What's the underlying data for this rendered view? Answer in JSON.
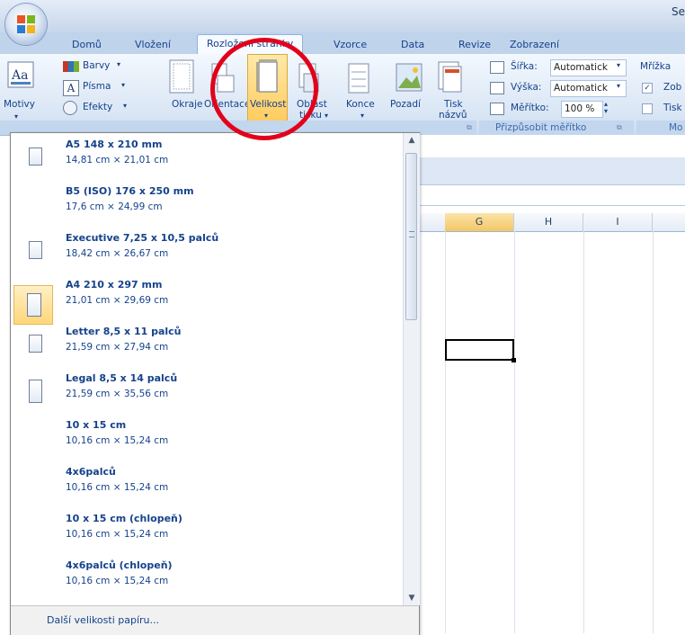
{
  "window": {
    "title_fragment": "Se"
  },
  "tabs": [
    {
      "label": "Domů",
      "active": false
    },
    {
      "label": "Vložení",
      "active": false
    },
    {
      "label": "Rozložení stránky",
      "active": true
    },
    {
      "label": "Vzorce",
      "active": false
    },
    {
      "label": "Data",
      "active": false
    },
    {
      "label": "Revize",
      "active": false
    },
    {
      "label": "Zobrazení",
      "active": false
    }
  ],
  "ribbon": {
    "motivy": {
      "label": "Motivy",
      "barvy": "Barvy",
      "pisma": "Písma",
      "efekty": "Efekty"
    },
    "page_setup": {
      "okraje": "Okraje",
      "orientace": "Orientace",
      "velikost": "Velikost",
      "oblast_tisku_1": "Oblast",
      "oblast_tisku_2": "tisku",
      "konce": "Konce",
      "pozadi": "Pozadí",
      "tisk_1": "Tisk",
      "tisk_2": "názvů"
    },
    "fit": {
      "sirka_label": "Šířka:",
      "sirka_value": "Automatick",
      "vyska_label": "Výška:",
      "vyska_value": "Automatick",
      "meritko_label": "Měřítko:",
      "meritko_value": "100 %",
      "group_label": "Přizpůsobit měřítko"
    },
    "sheet_options": {
      "label": "Mřížka",
      "zobrazit": "Zob",
      "tisk": "Tisk",
      "footer": "Mo"
    }
  },
  "sheet": {
    "columns": [
      {
        "label": "G",
        "selected": true
      },
      {
        "label": "H",
        "selected": false
      },
      {
        "label": "I",
        "selected": false
      }
    ]
  },
  "dropdown": {
    "items": [
      {
        "name": "A5 148 x 210 mm",
        "dims": "14,81 cm × 21,01 cm",
        "icon": "page-icon",
        "selected": false
      },
      {
        "name": "B5 (ISO) 176 x 250 mm",
        "dims": "17,6 cm × 24,99 cm",
        "icon": "",
        "selected": false
      },
      {
        "name": "Executive 7,25 x 10,5 palců",
        "dims": "18,42 cm × 26,67 cm",
        "icon": "page-icon",
        "selected": false
      },
      {
        "name": "A4 210 x 297 mm",
        "dims": "21,01 cm × 29,69 cm",
        "icon": "page-icon",
        "selected": true
      },
      {
        "name": "Letter 8,5 x 11 palců",
        "dims": "21,59 cm × 27,94 cm",
        "icon": "page-icon",
        "selected": false
      },
      {
        "name": "Legal 8,5 x 14 palců",
        "dims": "21,59 cm × 35,56 cm",
        "icon": "page-icon",
        "selected": false
      },
      {
        "name": "10 x 15 cm",
        "dims": "10,16 cm × 15,24 cm",
        "icon": "",
        "selected": false
      },
      {
        "name": "4x6palců",
        "dims": "10,16 cm × 15,24 cm",
        "icon": "",
        "selected": false
      },
      {
        "name": "10 x 15 cm (chlopeň)",
        "dims": "10,16 cm × 15,24 cm",
        "icon": "",
        "selected": false
      },
      {
        "name": "4x6palců (chlopeň)",
        "dims": "10,16 cm × 15,24 cm",
        "icon": "",
        "selected": false
      }
    ],
    "footer_label": "Další velikosti papíru..."
  },
  "colors": {
    "accent": "#15428b",
    "highlight": "#ffd77a",
    "annotation": "#e3001b"
  }
}
